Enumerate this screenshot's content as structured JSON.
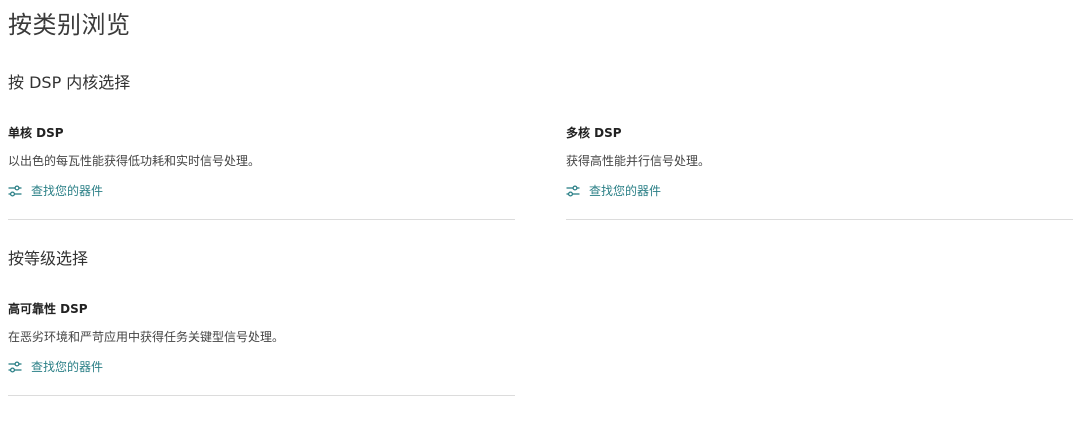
{
  "page": {
    "title": "按类别浏览"
  },
  "sections": [
    {
      "title": "按 DSP 内核选择",
      "cards": [
        {
          "title": "单核 DSP",
          "description": "以出色的每瓦性能获得低功耗和实时信号处理。",
          "link_label": "查找您的器件",
          "link_icon": "filter-sliders-icon"
        },
        {
          "title": "多核 DSP",
          "description": "获得高性能并行信号处理。",
          "link_label": "查找您的器件",
          "link_icon": "filter-sliders-icon"
        }
      ]
    },
    {
      "title": "按等级选择",
      "cards": [
        {
          "title": "高可靠性 DSP",
          "description": "在恶劣环境和严苛应用中获得任务关键型信号处理。",
          "link_label": "查找您的器件",
          "link_icon": "filter-sliders-icon"
        }
      ]
    }
  ],
  "colors": {
    "link": "#2a7f86",
    "divider": "#dcdcdc",
    "text": "#333333"
  }
}
